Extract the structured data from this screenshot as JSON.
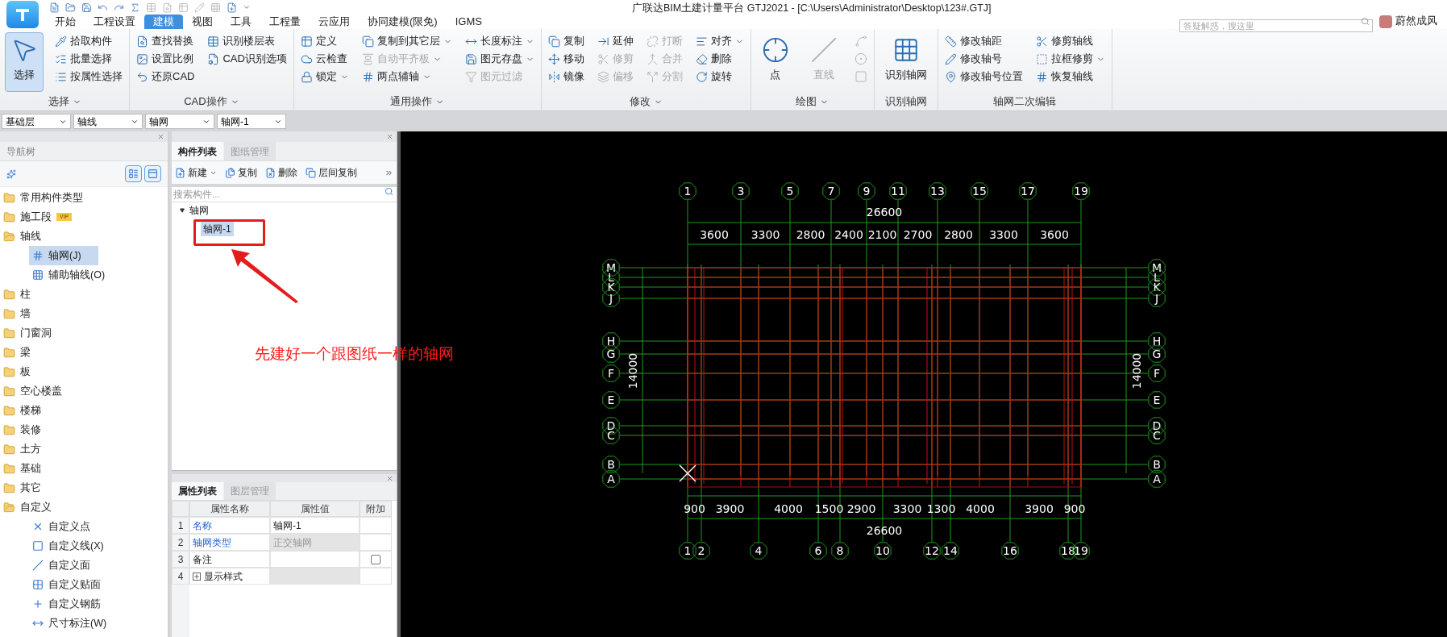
{
  "window": {
    "title": "广联达BIM土建计量平台 GTJ2021 - [C:\\Users\\Administrator\\Desktop\\123#.GTJ]"
  },
  "tabs": [
    {
      "label": "开始",
      "selected": false
    },
    {
      "label": "工程设置",
      "selected": false
    },
    {
      "label": "建模",
      "selected": true
    },
    {
      "label": "视图",
      "selected": false
    },
    {
      "label": "工具",
      "selected": false
    },
    {
      "label": "工程量",
      "selected": false
    },
    {
      "label": "云应用",
      "selected": false
    },
    {
      "label": "协同建模(限免)",
      "selected": false
    },
    {
      "label": "IGMS",
      "selected": false
    }
  ],
  "help_search": {
    "placeholder": "答疑解惑，搜这里"
  },
  "user": {
    "name": "蔚然成风"
  },
  "ribbon": [
    {
      "label": "选择",
      "menu": true,
      "columns": [
        [
          {
            "kind": "large",
            "label": "选择",
            "selected": true
          }
        ],
        [
          {
            "kind": "small",
            "label": "拾取构件"
          },
          {
            "kind": "small",
            "label": "批量选择"
          },
          {
            "kind": "small",
            "label": "按属性选择"
          }
        ]
      ]
    },
    {
      "label": "CAD操作",
      "menu": true,
      "columns": [
        [
          {
            "kind": "small",
            "label": "查找替换"
          },
          {
            "kind": "small",
            "label": "设置比例"
          },
          {
            "kind": "small",
            "label": "还原CAD"
          }
        ],
        [
          {
            "kind": "small",
            "label": "识别楼层表"
          },
          {
            "kind": "small",
            "label": "CAD识别选项"
          }
        ]
      ]
    },
    {
      "label": "通用操作",
      "menu": true,
      "columns": [
        [
          {
            "kind": "small",
            "label": "定义"
          },
          {
            "kind": "small",
            "label": "云检查"
          },
          {
            "kind": "small",
            "label": "锁定",
            "dropdown": true
          }
        ],
        [
          {
            "kind": "small",
            "label": "复制到其它层",
            "dropdown": true
          },
          {
            "kind": "small",
            "label": "自动平齐板",
            "dropdown": true,
            "disabled": true
          },
          {
            "kind": "small",
            "label": "两点辅轴",
            "dropdown": true
          }
        ],
        [
          {
            "kind": "small",
            "label": "长度标注",
            "dropdown": true
          },
          {
            "kind": "small",
            "label": "图元存盘",
            "dropdown": true
          },
          {
            "kind": "small",
            "label": "图元过滤",
            "disabled": true
          }
        ]
      ]
    },
    {
      "label": "修改",
      "menu": true,
      "columns": [
        [
          {
            "kind": "small",
            "label": "复制"
          },
          {
            "kind": "small",
            "label": "移动"
          },
          {
            "kind": "small",
            "label": "镜像"
          }
        ],
        [
          {
            "kind": "small",
            "label": "延伸"
          },
          {
            "kind": "small",
            "label": "修剪",
            "disabled": true
          },
          {
            "kind": "small",
            "label": "偏移",
            "disabled": true
          }
        ],
        [
          {
            "kind": "small",
            "label": "打断",
            "disabled": true
          },
          {
            "kind": "small",
            "label": "合并",
            "disabled": true
          },
          {
            "kind": "small",
            "label": "分割",
            "disabled": true
          }
        ],
        [
          {
            "kind": "small",
            "label": "对齐",
            "dropdown": true
          },
          {
            "kind": "small",
            "label": "删除"
          },
          {
            "kind": "small",
            "label": "旋转"
          }
        ]
      ]
    },
    {
      "label": "绘图",
      "menu": true,
      "columns": [
        [
          {
            "kind": "large",
            "label": "点",
            "selected": false
          }
        ],
        [
          {
            "kind": "large",
            "label": "直线",
            "selected": false,
            "disabled": true
          }
        ],
        [
          {
            "kind": "icon",
            "disabled": true
          },
          {
            "kind": "icon",
            "disabled": true
          },
          {
            "kind": "icon",
            "disabled": true
          }
        ]
      ]
    },
    {
      "label": "识别轴网",
      "menu": false,
      "columns": [
        [
          {
            "kind": "large",
            "label": "识别轴网",
            "selected": false
          }
        ]
      ]
    },
    {
      "label": "轴网二次编辑",
      "menu": false,
      "columns": [
        [
          {
            "kind": "small",
            "label": "修改轴距"
          },
          {
            "kind": "small",
            "label": "修改轴号"
          },
          {
            "kind": "small",
            "label": "修改轴号位置"
          }
        ],
        [
          {
            "kind": "small",
            "label": "修剪轴线"
          },
          {
            "kind": "small",
            "label": "拉框修剪",
            "dropdown": true
          },
          {
            "kind": "small",
            "label": "恢复轴线"
          }
        ]
      ]
    }
  ],
  "selectors": [
    "基础层",
    "轴线",
    "轴网",
    "轴网-1"
  ],
  "nav_tree": {
    "title": "导航树",
    "items": [
      {
        "label": "常用构件类型",
        "expanded": false
      },
      {
        "label": "施工段",
        "expanded": false,
        "badge": "VIP"
      },
      {
        "label": "轴线",
        "expanded": true,
        "children": [
          {
            "label": "轴网(J)",
            "kind": "grid",
            "selected": true
          },
          {
            "label": "辅助轴线(O)",
            "kind": "aux",
            "selected": false
          }
        ]
      },
      {
        "label": "柱",
        "expanded": false
      },
      {
        "label": "墙",
        "expanded": false
      },
      {
        "label": "门窗洞",
        "expanded": false
      },
      {
        "label": "梁",
        "expanded": false
      },
      {
        "label": "板",
        "expanded": false
      },
      {
        "label": "空心楼盖",
        "expanded": false
      },
      {
        "label": "楼梯",
        "expanded": false
      },
      {
        "label": "装修",
        "expanded": false
      },
      {
        "label": "土方",
        "expanded": false
      },
      {
        "label": "基础",
        "expanded": false
      },
      {
        "label": "其它",
        "expanded": false
      },
      {
        "label": "自定义",
        "expanded": true,
        "children": [
          {
            "label": "自定义点",
            "kind": "point",
            "selected": false
          },
          {
            "label": "自定义线(X)",
            "kind": "line",
            "selected": false
          },
          {
            "label": "自定义面",
            "kind": "face",
            "selected": false
          },
          {
            "label": "自定义贴面",
            "kind": "facing",
            "selected": false
          },
          {
            "label": "自定义钢筋",
            "kind": "rebar",
            "selected": false
          },
          {
            "label": "尺寸标注(W)",
            "kind": "dimension",
            "selected": false
          }
        ]
      }
    ]
  },
  "component_panel": {
    "tabs": [
      {
        "label": "构件列表",
        "selected": true
      },
      {
        "label": "图纸管理",
        "selected": false
      }
    ],
    "toolbar": [
      {
        "label": "新建",
        "kind": "new",
        "dropdown": true
      },
      {
        "label": "复制",
        "kind": "copy"
      },
      {
        "label": "删除",
        "kind": "delete"
      },
      {
        "label": "层间复制",
        "kind": "floor-copy"
      }
    ],
    "search": {
      "placeholder": "搜索构件..."
    },
    "tree": [
      {
        "label": "轴网",
        "expanded": true,
        "children": [
          {
            "label": "轴网-1",
            "selected": true
          }
        ]
      }
    ]
  },
  "property_panel": {
    "tabs": [
      {
        "label": "属性列表",
        "selected": true
      },
      {
        "label": "图层管理",
        "selected": false
      }
    ],
    "columns": [
      "属性名称",
      "属性值",
      "附加"
    ],
    "rows": [
      {
        "index": "1",
        "name": "名称",
        "linked": true,
        "value": "轴网-1",
        "locked": false
      },
      {
        "index": "2",
        "name": "轴网类型",
        "linked": true,
        "value": "正交轴网",
        "locked": true
      },
      {
        "index": "3",
        "name": "备注",
        "linked": false,
        "value": "",
        "locked": false,
        "extra_checked": false
      },
      {
        "index": "4",
        "name": "显示样式",
        "linked": false,
        "expandable": true,
        "expanded": false,
        "value": "",
        "locked": true
      }
    ]
  },
  "annotation": {
    "text": "先建好一个跟图纸一样的轴网"
  },
  "drawing": {
    "top_axes": [
      "1",
      "3",
      "5",
      "7",
      "9",
      "11",
      "13",
      "15",
      "17",
      "19"
    ],
    "bottom_axes": [
      "1",
      "2",
      "4",
      "6",
      "8",
      "10",
      "12",
      "14",
      "16",
      "18",
      "19"
    ],
    "left_axes": [
      "M",
      "L",
      "K",
      "J",
      "H",
      "G",
      "F",
      "E",
      "D",
      "C",
      "B",
      "A"
    ],
    "right_axes": [
      "M",
      "L",
      "K",
      "J",
      "H",
      "G",
      "F",
      "E",
      "D",
      "C",
      "B",
      "A"
    ],
    "top_total": "26600",
    "top_spans": [
      "3600",
      "3300",
      "2800",
      "2400",
      "2100",
      "2700",
      "2800",
      "3300",
      "3600"
    ],
    "bottom_total": "26600",
    "bottom_spans": [
      "900",
      "3900",
      "4000",
      "1500",
      "2900",
      "3300",
      "1300",
      "4000",
      "3900",
      "900"
    ],
    "left_total": "14000",
    "right_total": "14000"
  }
}
